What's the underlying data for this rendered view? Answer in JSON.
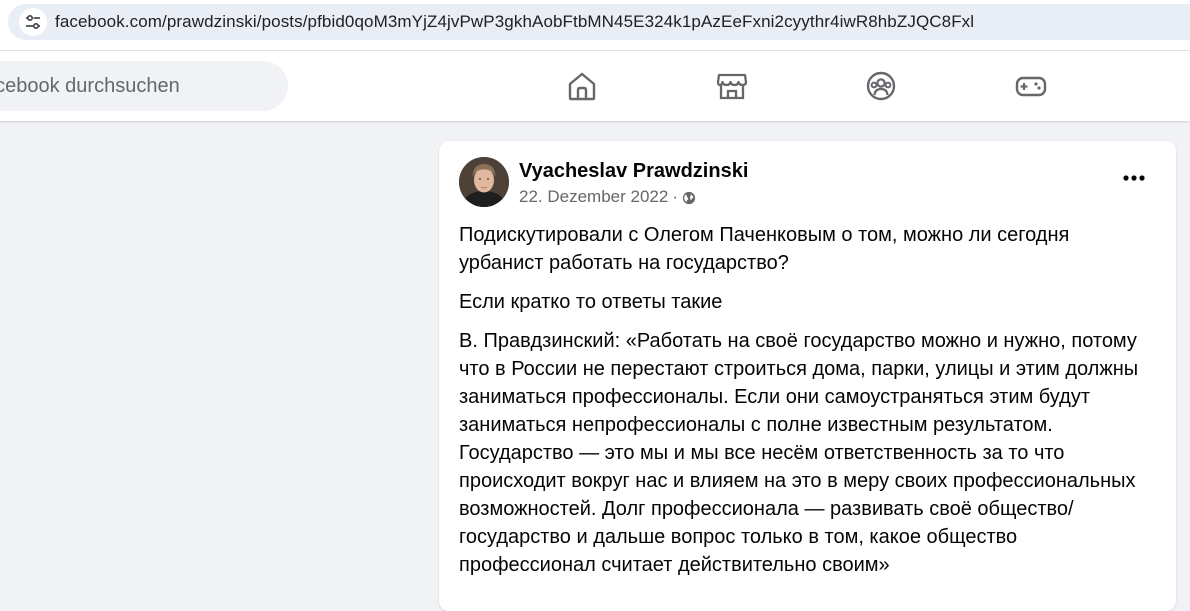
{
  "browser": {
    "url": "facebook.com/prawdzinski/posts/pfbid0qoM3mYjZ4jvPwP3gkhAobFtbMN45E324k1pAzEeFxni2cyythr4iwR8hbZJQC8Fxl",
    "site_info_icon": "tune-icon"
  },
  "header": {
    "search_placeholder": "acebook durchsuchen",
    "nav_icons": [
      "home-icon",
      "marketplace-icon",
      "groups-icon",
      "gaming-icon"
    ]
  },
  "post": {
    "author": "Vyacheslav Prawdzinski",
    "date": "22. Dezember 2022",
    "separator": "·",
    "audience_icon": "globe-icon",
    "more_icon": "more-options-icon",
    "paragraphs": [
      "Подискутировали с Олегом Паченковым о том, можно ли сегодня урбанист работать на государство?",
      "Если кратко то ответы такие",
      "В. Правдзинский: «Работать на своё государство можно и нужно, потому что в России не перестают строиться дома, парки, улицы и этим должны заниматься профессионалы. Если они самоустраняться этим будут заниматься непрофессионалы с полне известным результатом. Государство — это мы и мы все несём ответственность за то что происходит вокруг нас и влияем на это в меру своих профессиональных возможностей. Долг профессионала — развивать своё общество/государство и дальше вопрос только в том, какое общество профессионал считает действительно своим»"
    ]
  },
  "colors": {
    "page_bg": "#f0f2f5",
    "text_primary": "#050505",
    "text_secondary": "#65676b",
    "icon": "#65676b"
  }
}
